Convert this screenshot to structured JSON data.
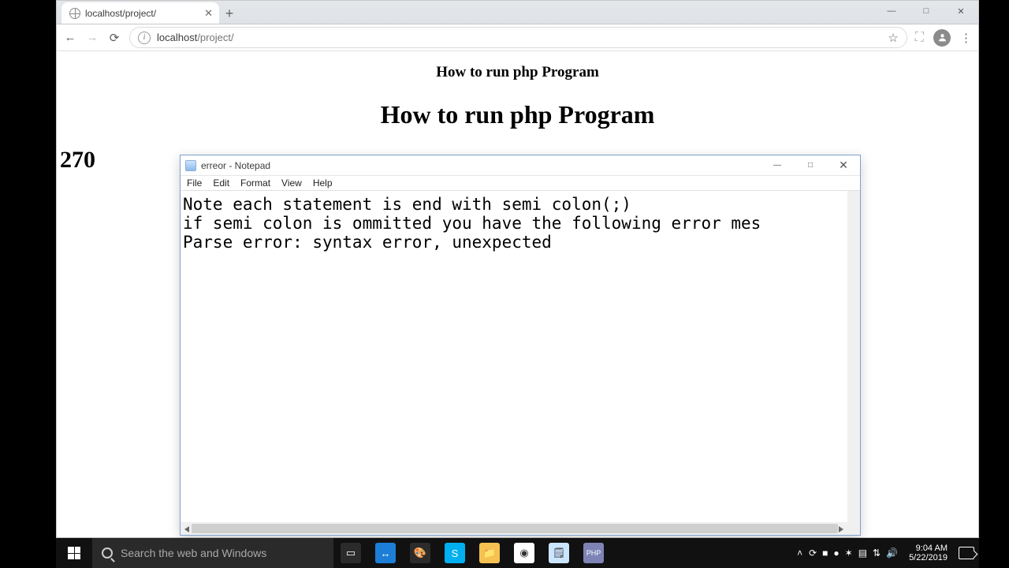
{
  "browser": {
    "tab_title": "localhost/project/",
    "url_host": "localhost",
    "url_path": "/project/",
    "page": {
      "title_small": "How to run php Program",
      "title_large": "How to run php Program",
      "value": "270"
    }
  },
  "notepad": {
    "title": "erreor - Notepad",
    "menu": [
      "File",
      "Edit",
      "Format",
      "View",
      "Help"
    ],
    "content": "Note each statement is end with semi colon(;)\nif semi colon is ommitted you have the following error mes\nParse error: syntax error, unexpected"
  },
  "taskbar": {
    "search_placeholder": "Search the web and Windows",
    "apps": [
      {
        "name": "task-view-icon",
        "bg": "#2b2b2b",
        "label": "▭"
      },
      {
        "name": "teamviewer-icon",
        "bg": "#1c7ed6",
        "label": "↔"
      },
      {
        "name": "paint-icon",
        "bg": "#2b2b2b",
        "label": "🎨"
      },
      {
        "name": "skype-icon",
        "bg": "#00aff0",
        "label": "S"
      },
      {
        "name": "file-explorer-icon",
        "bg": "#f5c252",
        "label": "📁"
      },
      {
        "name": "chrome-icon",
        "bg": "#ffffff",
        "label": "◉"
      },
      {
        "name": "notepad-icon",
        "bg": "#cce5ff",
        "label": "🗒"
      },
      {
        "name": "php-icon",
        "bg": "#7d84b5",
        "label": "PHP"
      }
    ],
    "tray_icons": [
      "sync-icon",
      "defender-icon",
      "avast-icon",
      "xampp-icon",
      "network-icon",
      "wifi-icon",
      "volume-icon"
    ],
    "time": "9:04 AM",
    "date": "5/22/2019"
  }
}
